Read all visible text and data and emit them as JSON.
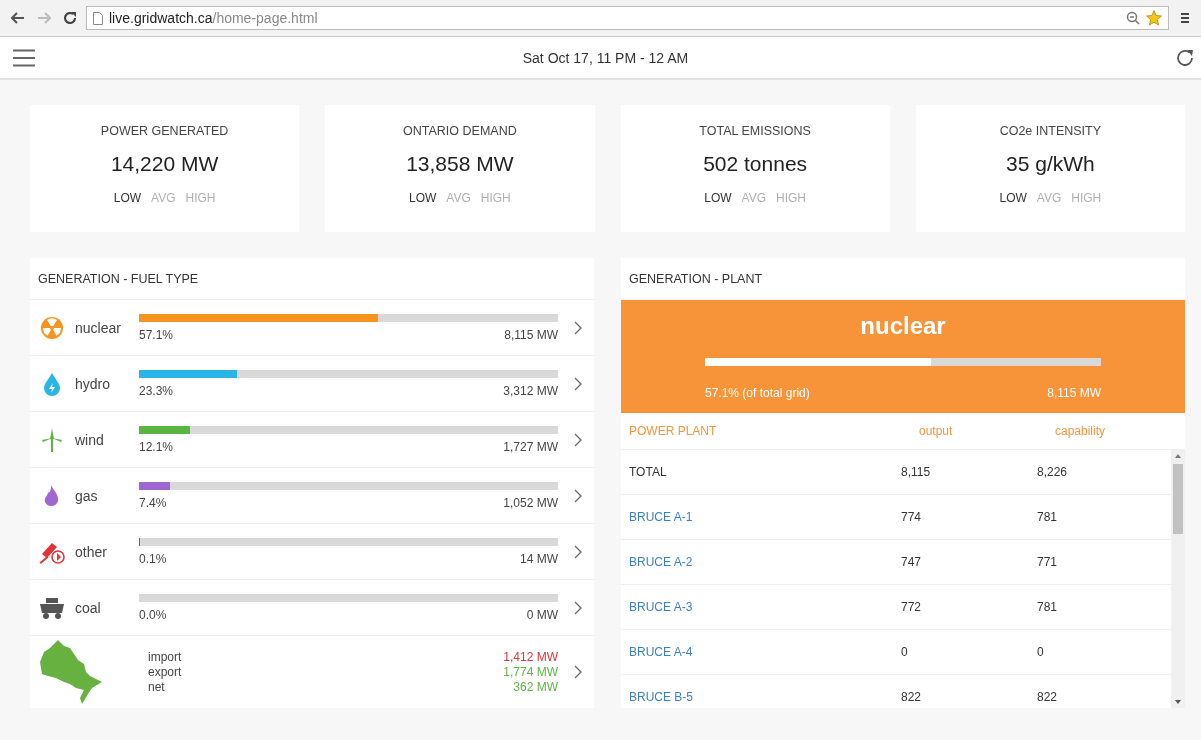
{
  "browser": {
    "address": {
      "host": "live.gridwatch.ca",
      "path": "/home-page.html"
    },
    "bookmarked": true
  },
  "header": {
    "title": "Sat Oct 17, 11 PM - 12 AM"
  },
  "stats": [
    {
      "label": "POWER GENERATED",
      "value": "14,220 MW",
      "levels": [
        {
          "label": "LOW",
          "selected": true
        },
        {
          "label": "AVG",
          "selected": false
        },
        {
          "label": "HIGH",
          "selected": false
        }
      ]
    },
    {
      "label": "ONTARIO DEMAND",
      "value": "13,858 MW",
      "levels": [
        {
          "label": "LOW",
          "selected": true
        },
        {
          "label": "AVG",
          "selected": false
        },
        {
          "label": "HIGH",
          "selected": false
        }
      ]
    },
    {
      "label": "TOTAL EMISSIONS",
      "value": "502 tonnes",
      "levels": [
        {
          "label": "LOW",
          "selected": true
        },
        {
          "label": "AVG",
          "selected": false
        },
        {
          "label": "HIGH",
          "selected": false
        }
      ]
    },
    {
      "label": "CO2e INTENSITY",
      "value": "35 g/kWh",
      "levels": [
        {
          "label": "LOW",
          "selected": true
        },
        {
          "label": "AVG",
          "selected": false
        },
        {
          "label": "HIGH",
          "selected": false
        }
      ]
    }
  ],
  "fuel_panel": {
    "title": "GENERATION - FUEL TYPE",
    "fuels": [
      {
        "kind": "nuclear",
        "name": "nuclear",
        "level": 0.571,
        "percent": "57.1%",
        "output": "8,115 MW",
        "color": "#f7941d"
      },
      {
        "kind": "hydro",
        "name": "hydro",
        "level": 0.233,
        "percent": "23.3%",
        "output": "3,312 MW",
        "color": "#29b6e6"
      },
      {
        "kind": "wind",
        "name": "wind",
        "level": 0.121,
        "percent": "12.1%",
        "output": "1,727 MW",
        "color": "#5bb543"
      },
      {
        "kind": "gas",
        "name": "gas",
        "level": 0.074,
        "percent": "7.4%",
        "output": "1,052 MW",
        "color": "#a066d3"
      },
      {
        "kind": "other",
        "name": "other",
        "level": 0.003,
        "percent": "0.1%",
        "output": "14 MW",
        "color": "#e0333a"
      },
      {
        "kind": "coal",
        "name": "coal",
        "level": 0,
        "percent": "0.0%",
        "output": "0 MW",
        "color": "#555555"
      }
    ],
    "trade": [
      {
        "label": "import",
        "value": "1,412 MW",
        "color": "#e0333a"
      },
      {
        "label": "export",
        "value": "1,774 MW",
        "color": "#5bb543"
      },
      {
        "label": "net",
        "value": "362 MW",
        "color": "#5bb543"
      }
    ]
  },
  "plant_panel": {
    "title": "GENERATION - PLANT",
    "fuel": "nuclear",
    "level": 0.571,
    "share": "57.1% (of total grid)",
    "output": "8,115 MW",
    "columns": [
      "POWER PLANT",
      "output",
      "capability"
    ],
    "rows": [
      {
        "kind": "total",
        "name": "TOTAL",
        "output": "8,115",
        "capability": "8,226"
      },
      {
        "kind": "plant",
        "name": "BRUCE A-1",
        "output": "774",
        "capability": "781"
      },
      {
        "kind": "plant",
        "name": "BRUCE A-2",
        "output": "747",
        "capability": "771"
      },
      {
        "kind": "plant",
        "name": "BRUCE A-3",
        "output": "772",
        "capability": "781"
      },
      {
        "kind": "plant",
        "name": "BRUCE A-4",
        "output": "0",
        "capability": "0"
      },
      {
        "kind": "plant",
        "name": "BRUCE B-5",
        "output": "822",
        "capability": "822"
      }
    ]
  }
}
